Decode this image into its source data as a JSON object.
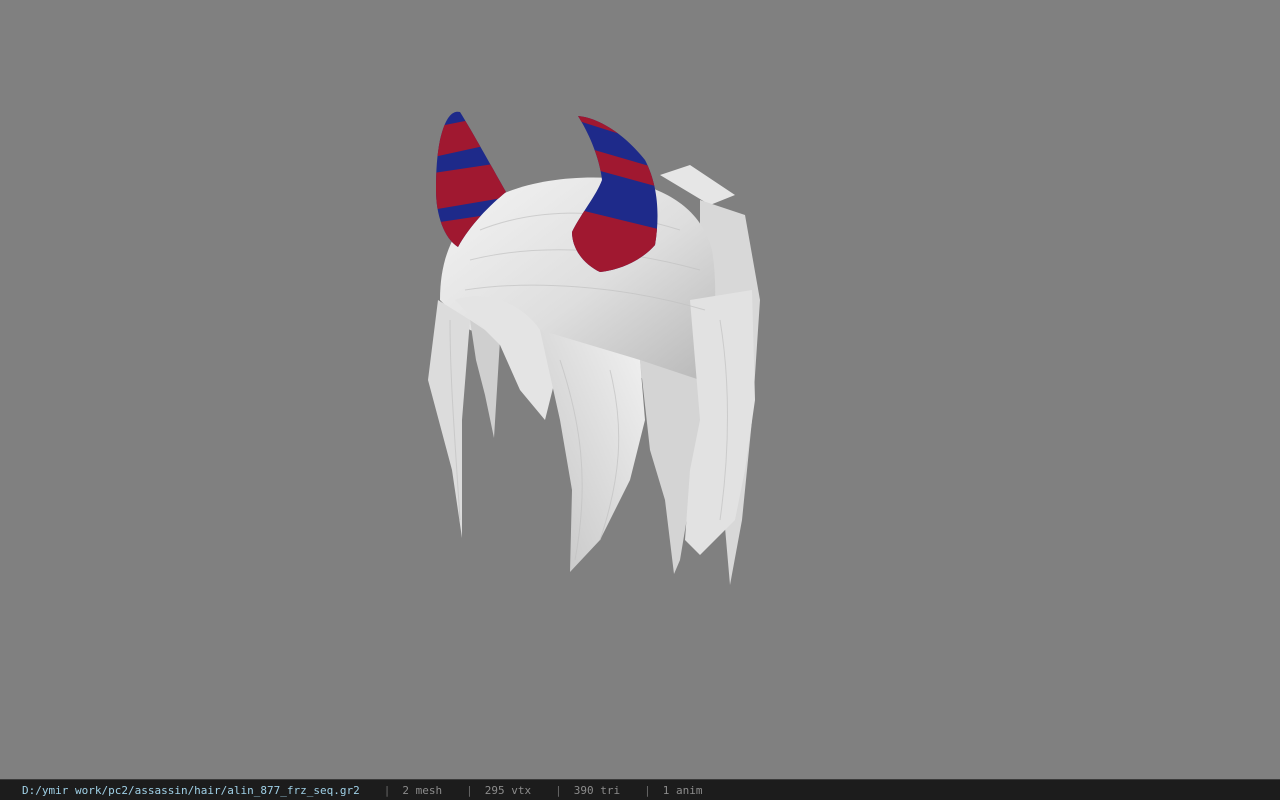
{
  "viewer": {
    "background_color": "#808080",
    "model": {
      "subject": "white hair mesh with red and blue striped horns",
      "hair_color": "#e8e8e8",
      "horn_colors": [
        "#a01830",
        "#1e2a8a"
      ]
    }
  },
  "status_bar": {
    "file_path": "D:/ymir work/pc2/assassin/hair/alin_877_frz_seq.gr2",
    "separator": "|",
    "mesh": "2 mesh",
    "vtx": "295 vtx",
    "tri": "390 tri",
    "anim": "1 anim",
    "path_color": "#9fd0e6",
    "background_color": "#1c1c1c"
  }
}
